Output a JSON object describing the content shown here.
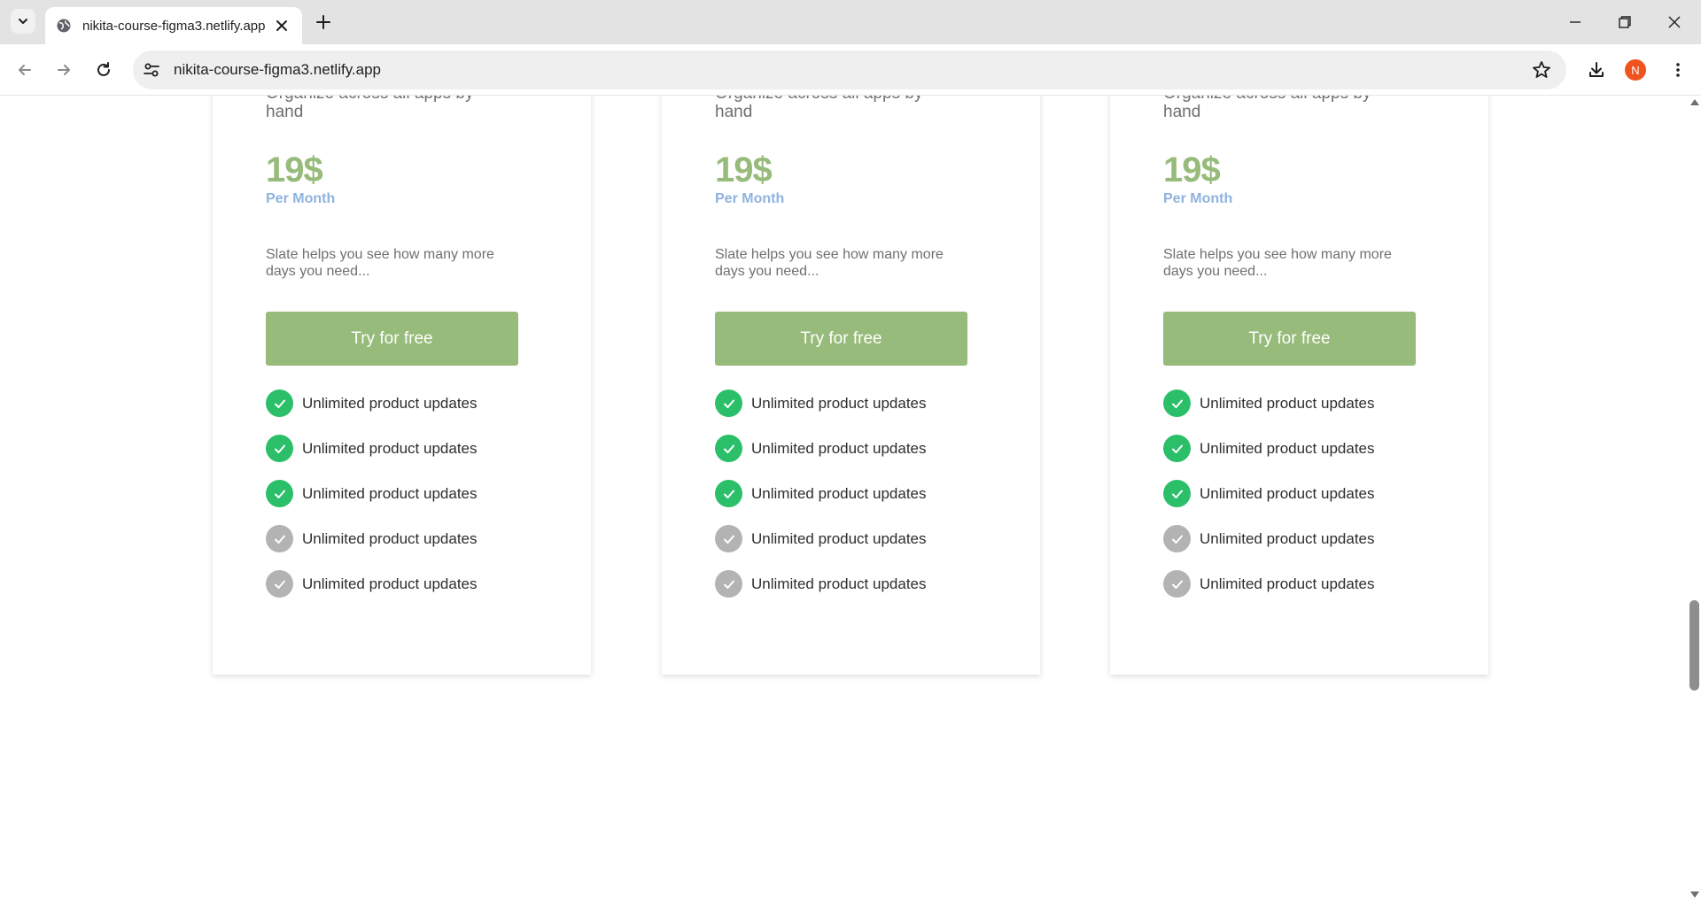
{
  "browser": {
    "tab_title": "nikita-course-figma3.netlify.app",
    "url": "nikita-course-figma3.netlify.app",
    "profile_initial": "N",
    "accent_profile_color": "#f0541e"
  },
  "plans": [
    {
      "tagline": "Organize across all apps by hand",
      "price": "19$",
      "period": "Per Month",
      "description": "Slate helps you see how many more days you need...",
      "cta_label": "Try for free",
      "features": [
        {
          "label": "Unlimited product updates",
          "included": true
        },
        {
          "label": "Unlimited product updates",
          "included": true
        },
        {
          "label": "Unlimited product updates",
          "included": true
        },
        {
          "label": "Unlimited product updates",
          "included": false
        },
        {
          "label": "Unlimited product updates",
          "included": false
        }
      ]
    },
    {
      "tagline": "Organize across all apps by hand",
      "price": "19$",
      "period": "Per Month",
      "description": "Slate helps you see how many more days you need...",
      "cta_label": "Try for free",
      "features": [
        {
          "label": "Unlimited product updates",
          "included": true
        },
        {
          "label": "Unlimited product updates",
          "included": true
        },
        {
          "label": "Unlimited product updates",
          "included": true
        },
        {
          "label": "Unlimited product updates",
          "included": false
        },
        {
          "label": "Unlimited product updates",
          "included": false
        }
      ]
    },
    {
      "tagline": "Organize across all apps by hand",
      "price": "19$",
      "period": "Per Month",
      "description": "Slate helps you see how many more days you need...",
      "cta_label": "Try for free",
      "features": [
        {
          "label": "Unlimited product updates",
          "included": true
        },
        {
          "label": "Unlimited product updates",
          "included": true
        },
        {
          "label": "Unlimited product updates",
          "included": true
        },
        {
          "label": "Unlimited product updates",
          "included": false
        },
        {
          "label": "Unlimited product updates",
          "included": false
        }
      ]
    }
  ],
  "colors": {
    "accent_green": "#97bb7a",
    "period_blue": "#8fb3df",
    "check_included": "#2bbf6a",
    "check_excluded": "#b3b3b3"
  }
}
